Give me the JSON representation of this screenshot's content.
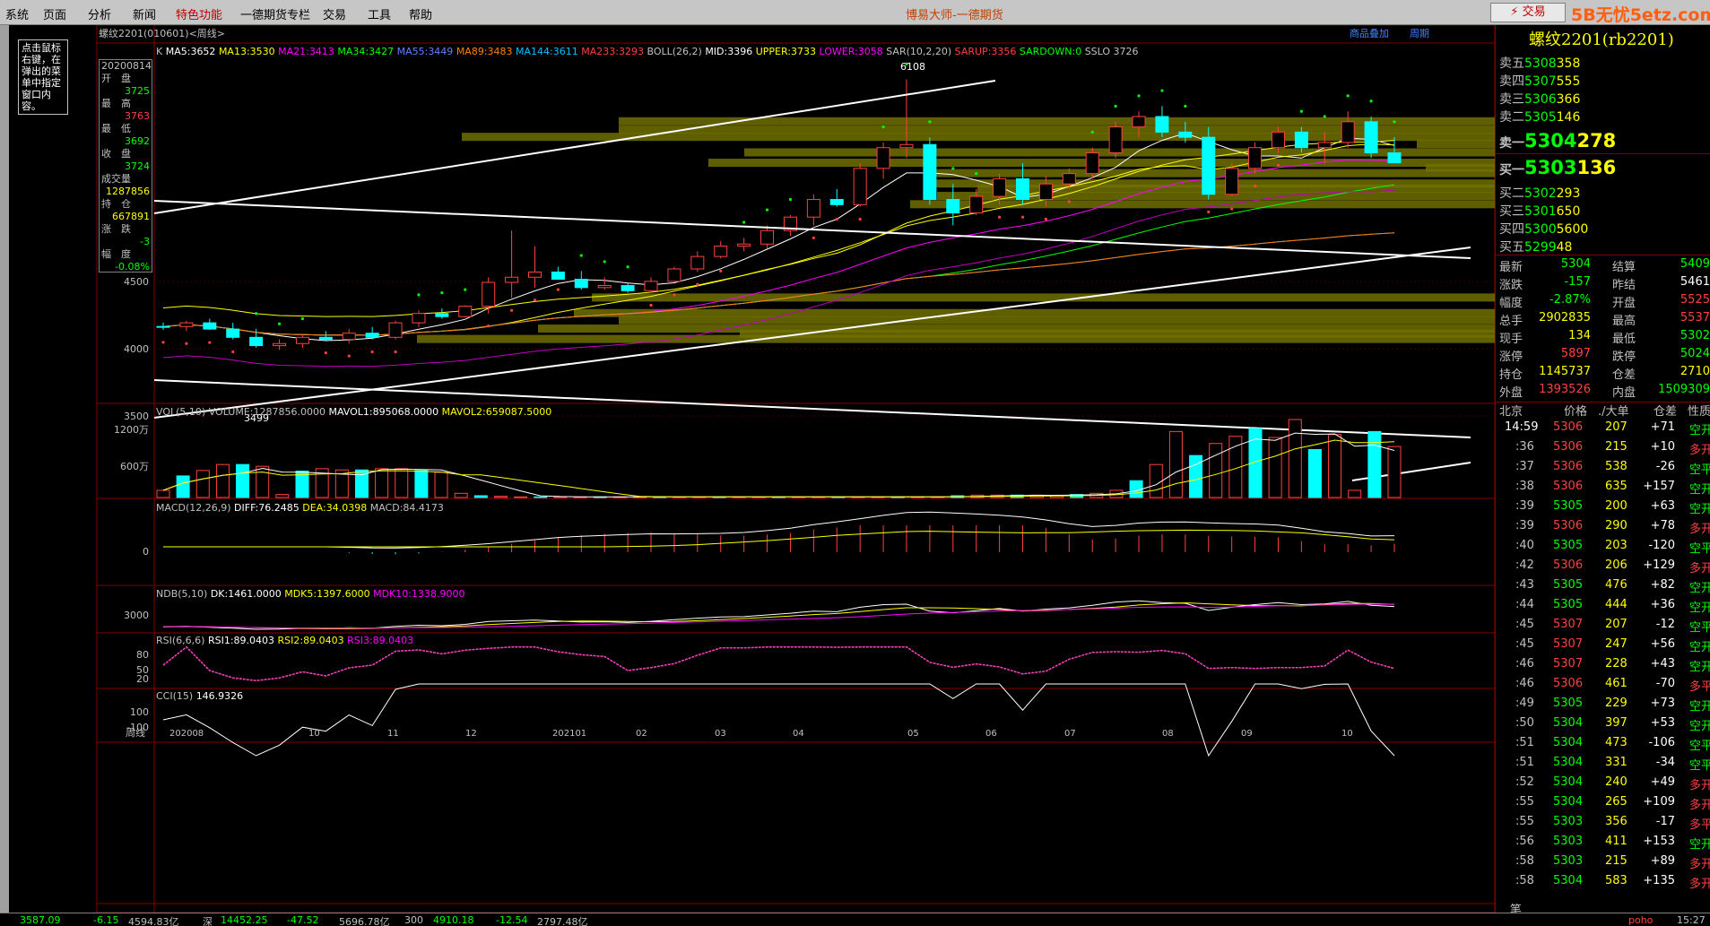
{
  "menu": {
    "items": [
      "系统",
      "页面",
      "分析",
      "新闻",
      "特色功能",
      "一德期货专栏",
      "交易",
      "工具",
      "帮助"
    ],
    "app_title": "博易大师-一德期货",
    "trade_button": "⚡ 交易",
    "watermark": "5B无忧5etz.com"
  },
  "hint": "点击鼠标右键，在弹出的菜单中指定窗口内容。",
  "chart": {
    "symbol_line": "螺纹2201(010601)<周线>",
    "toolbar_links": [
      "商品叠加",
      "周期"
    ],
    "indicator_line": [
      {
        "text": "K",
        "color": "#c0c0c0"
      },
      {
        "text": "MA5:3652",
        "color": "#ffffff"
      },
      {
        "text": "MA13:3530",
        "color": "#ffff00"
      },
      {
        "text": "MA21:3413",
        "color": "#ff00ff"
      },
      {
        "text": "MA34:3427",
        "color": "#00ff00"
      },
      {
        "text": "MA55:3449",
        "color": "#6080ff"
      },
      {
        "text": "MA89:3483",
        "color": "#ff8000"
      },
      {
        "text": "MA144:3611",
        "color": "#00c0ff"
      },
      {
        "text": "MA233:3293",
        "color": "#ff4040"
      },
      {
        "text": "BOLL(26,2)",
        "color": "#c0c0c0"
      },
      {
        "text": "MID:3396",
        "color": "#ffffff"
      },
      {
        "text": "UPPER:3733",
        "color": "#ffff00"
      },
      {
        "text": "LOWER:3058",
        "color": "#ff00ff"
      },
      {
        "text": "SAR(10,2,20)",
        "color": "#c0c0c0"
      },
      {
        "text": "SARUP:3356",
        "color": "#ff4040"
      },
      {
        "text": "SARDOWN:0",
        "color": "#00ff00"
      },
      {
        "text": "SSLO 3726",
        "color": "#c0c0c0"
      }
    ],
    "price_axis": [
      "4500",
      "4000",
      "3500"
    ],
    "marks": {
      "high": "6108",
      "low": "3499"
    },
    "vol_line": [
      {
        "text": "VOL(5,10)",
        "color": "#c0c0c0"
      },
      {
        "text": "VOLUME:1287856.0000",
        "color": "#c0c0c0"
      },
      {
        "text": "MAVOL1:895068.0000",
        "color": "#ffffff"
      },
      {
        "text": "MAVOL2:659087.5000",
        "color": "#ffff00"
      }
    ],
    "vol_axis": [
      "1200万",
      "600万"
    ],
    "macd_line": [
      {
        "text": "MACD(12,26,9)",
        "color": "#c0c0c0"
      },
      {
        "text": "DIFF:76.2485",
        "color": "#ffffff"
      },
      {
        "text": "DEA:34.0398",
        "color": "#ffff00"
      },
      {
        "text": "MACD:84.4173",
        "color": "#c0c0c0"
      }
    ],
    "macd_axis": [
      "0"
    ],
    "ndb_line": [
      {
        "text": "NDB(5,10)",
        "color": "#c0c0c0"
      },
      {
        "text": "DK:1461.0000",
        "color": "#ffffff"
      },
      {
        "text": "MDK5:1397.6000",
        "color": "#ffff00"
      },
      {
        "text": "MDK10:1338.9000",
        "color": "#ff00ff"
      }
    ],
    "ndb_axis": [
      "3000"
    ],
    "rsi_line": [
      {
        "text": "RSI(6,6,6)",
        "color": "#c0c0c0"
      },
      {
        "text": "RSI1:89.0403",
        "color": "#ffffff"
      },
      {
        "text": "RSI2:89.0403",
        "color": "#ffff00"
      },
      {
        "text": "RSI3:89.0403",
        "color": "#ff00ff"
      }
    ],
    "rsi_axis": [
      "80",
      "50",
      "20"
    ],
    "cci_line": [
      {
        "text": "CCI(15)",
        "color": "#c0c0c0"
      },
      {
        "text": "146.9326",
        "color": "#ffffff"
      }
    ],
    "cci_axis": [
      "100",
      "-100"
    ],
    "period_label": "周线",
    "time_axis": [
      "202008",
      "10",
      "11",
      "12",
      "202101",
      "02",
      "03",
      "04",
      "05",
      "06",
      "07",
      "08",
      "09",
      "10"
    ]
  },
  "infobox": [
    {
      "label": "20200814",
      "value": ""
    },
    {
      "label": "开　盘",
      "value": "3725",
      "color": "#00ff00"
    },
    {
      "label": "最　高",
      "value": "3763",
      "color": "#ff4040"
    },
    {
      "label": "最　低",
      "value": "3692",
      "color": "#00ff00"
    },
    {
      "label": "收　盘",
      "value": "3724",
      "color": "#00ff00"
    },
    {
      "label": "成交量",
      "value": "1287856",
      "color": "#ffff00"
    },
    {
      "label": "持　仓",
      "value": "667891",
      "color": "#ffff00"
    },
    {
      "label": "涨　跌",
      "value": "-3",
      "color": "#00ff00"
    },
    {
      "label": "幅　度",
      "value": "-0.08%",
      "color": "#00ff00"
    }
  ],
  "quote": {
    "title": "螺纹2201(rb2201)",
    "asks": [
      {
        "label": "卖五",
        "price": "5308",
        "qty": "358"
      },
      {
        "label": "卖四",
        "price": "5307",
        "qty": "555"
      },
      {
        "label": "卖三",
        "price": "5306",
        "qty": "366"
      },
      {
        "label": "卖二",
        "price": "5305",
        "qty": "146"
      },
      {
        "label": "卖一",
        "price": "5304",
        "qty": "278"
      }
    ],
    "bids": [
      {
        "label": "买一",
        "price": "5303",
        "qty": "136"
      },
      {
        "label": "买二",
        "price": "5302",
        "qty": "293"
      },
      {
        "label": "买三",
        "price": "5301",
        "qty": "650"
      },
      {
        "label": "买四",
        "price": "5300",
        "qty": "5600"
      },
      {
        "label": "买五",
        "price": "5299",
        "qty": "48"
      }
    ],
    "stats": [
      {
        "l1": "最新",
        "v1": "5304",
        "c1": "#00ff00",
        "l2": "结算",
        "v2": "5409",
        "c2": "#00ff00"
      },
      {
        "l1": "涨跌",
        "v1": "-157",
        "c1": "#00ff00",
        "l2": "昨结",
        "v2": "5461",
        "c2": "#ffffff"
      },
      {
        "l1": "幅度",
        "v1": "-2.87%",
        "c1": "#00ff00",
        "l2": "开盘",
        "v2": "5525",
        "c2": "#ff4040"
      },
      {
        "l1": "总手",
        "v1": "2902835",
        "c1": "#ffff00",
        "l2": "最高",
        "v2": "5537",
        "c2": "#ff4040"
      },
      {
        "l1": "现手",
        "v1": "134",
        "c1": "#ffff00",
        "l2": "最低",
        "v2": "5302",
        "c2": "#00ff00"
      },
      {
        "l1": "涨停",
        "v1": "5897",
        "c1": "#ff4040",
        "l2": "跌停",
        "v2": "5024",
        "c2": "#00ff00"
      },
      {
        "l1": "持仓",
        "v1": "1145737",
        "c1": "#ffff00",
        "l2": "仓差",
        "v2": "2710",
        "c2": "#ffff00"
      },
      {
        "l1": "外盘",
        "v1": "1393526",
        "c1": "#ff4040",
        "l2": "内盘",
        "v2": "1509309",
        "c2": "#00ff00"
      }
    ],
    "tick_header": {
      "c1": "北京",
      "c2": "价格",
      "c3": "./大单",
      "c4": "仓差",
      "c5": "性质"
    },
    "ticks": [
      {
        "t": "14:59",
        "p": "5306",
        "v": "207",
        "d": "+71",
        "n": "空开"
      },
      {
        "t": ":36",
        "p": "5306",
        "v": "215",
        "d": "+10",
        "n": "多开"
      },
      {
        "t": ":37",
        "p": "5306",
        "v": "538",
        "d": "-26",
        "n": "空平"
      },
      {
        "t": ":38",
        "p": "5306",
        "v": "635",
        "d": "+157",
        "n": "空开"
      },
      {
        "t": ":39",
        "p": "5305",
        "v": "200",
        "d": "+63",
        "n": "空开"
      },
      {
        "t": ":39",
        "p": "5306",
        "v": "290",
        "d": "+78",
        "n": "多开"
      },
      {
        "t": ":40",
        "p": "5305",
        "v": "203",
        "d": "-120",
        "n": "空平"
      },
      {
        "t": ":42",
        "p": "5306",
        "v": "206",
        "d": "+129",
        "n": "多开"
      },
      {
        "t": ":43",
        "p": "5305",
        "v": "476",
        "d": "+82",
        "n": "空开"
      },
      {
        "t": ":44",
        "p": "5305",
        "v": "444",
        "d": "+36",
        "n": "空开"
      },
      {
        "t": ":45",
        "p": "5307",
        "v": "207",
        "d": "-12",
        "n": "空平"
      },
      {
        "t": ":45",
        "p": "5307",
        "v": "247",
        "d": "+56",
        "n": "空开"
      },
      {
        "t": ":46",
        "p": "5307",
        "v": "228",
        "d": "+43",
        "n": "空开"
      },
      {
        "t": ":46",
        "p": "5306",
        "v": "461",
        "d": "-70",
        "n": "多平"
      },
      {
        "t": ":49",
        "p": "5305",
        "v": "229",
        "d": "+73",
        "n": "空开"
      },
      {
        "t": ":50",
        "p": "5304",
        "v": "397",
        "d": "+53",
        "n": "空开"
      },
      {
        "t": ":51",
        "p": "5304",
        "v": "473",
        "d": "-106",
        "n": "空平"
      },
      {
        "t": ":51",
        "p": "5304",
        "v": "331",
        "d": "-34",
        "n": "空平"
      },
      {
        "t": ":52",
        "p": "5304",
        "v": "240",
        "d": "+49",
        "n": "多开"
      },
      {
        "t": ":55",
        "p": "5304",
        "v": "265",
        "d": "+109",
        "n": "多开"
      },
      {
        "t": ":55",
        "p": "5303",
        "v": "356",
        "d": "-17",
        "n": "多平"
      },
      {
        "t": ":56",
        "p": "5303",
        "v": "411",
        "d": "+153",
        "n": "空开"
      },
      {
        "t": ":58",
        "p": "5303",
        "v": "215",
        "d": "+89",
        "n": "多开"
      },
      {
        "t": ":58",
        "p": "5304",
        "v": "583",
        "d": "+135",
        "n": "多开"
      }
    ],
    "footer_label": "笔"
  },
  "statusbar": [
    {
      "text": "3587.09",
      "color": "#00ff00"
    },
    {
      "text": "-6.15",
      "color": "#00ff00"
    },
    {
      "text": "4594.83亿",
      "color": "#c0c0c0"
    },
    {
      "text": "深",
      "color": "#c0c0c0"
    },
    {
      "text": "14452.25",
      "color": "#00ff00"
    },
    {
      "text": "-47.52",
      "color": "#00ff00"
    },
    {
      "text": "5696.78亿",
      "color": "#c0c0c0"
    },
    {
      "text": "300",
      "color": "#c0c0c0"
    },
    {
      "text": "4910.18",
      "color": "#00ff00"
    },
    {
      "text": "-12.54",
      "color": "#00ff00"
    },
    {
      "text": "2797.48亿",
      "color": "#c0c0c0"
    },
    {
      "text": "poho",
      "color": "#ff4040"
    },
    {
      "text": "15:27",
      "color": "#c0c0c0"
    }
  ],
  "candles": [
    [
      3725,
      3763,
      3692,
      3724
    ],
    [
      3724,
      3780,
      3680,
      3760
    ],
    [
      3760,
      3800,
      3690,
      3700
    ],
    [
      3700,
      3760,
      3600,
      3620
    ],
    [
      3620,
      3700,
      3520,
      3540
    ],
    [
      3540,
      3600,
      3499,
      3560
    ],
    [
      3560,
      3650,
      3520,
      3620
    ],
    [
      3620,
      3680,
      3590,
      3600
    ],
    [
      3600,
      3700,
      3560,
      3660
    ],
    [
      3660,
      3720,
      3600,
      3620
    ],
    [
      3620,
      3780,
      3600,
      3760
    ],
    [
      3760,
      3880,
      3720,
      3850
    ],
    [
      3850,
      3900,
      3800,
      3820
    ],
    [
      3820,
      3930,
      3810,
      3920
    ],
    [
      3920,
      4200,
      3850,
      4150
    ],
    [
      4150,
      4650,
      4000,
      4200
    ],
    [
      4200,
      4500,
      4100,
      4250
    ],
    [
      4250,
      4300,
      4200,
      4180
    ],
    [
      4180,
      4260,
      4080,
      4100
    ],
    [
      4100,
      4200,
      4080,
      4120
    ],
    [
      4120,
      4150,
      4050,
      4070
    ],
    [
      4070,
      4200,
      4050,
      4160
    ],
    [
      4160,
      4300,
      4150,
      4280
    ],
    [
      4280,
      4450,
      4250,
      4400
    ],
    [
      4400,
      4550,
      4380,
      4500
    ],
    [
      4500,
      4580,
      4450,
      4520
    ],
    [
      4520,
      4700,
      4480,
      4650
    ],
    [
      4650,
      4800,
      4600,
      4780
    ],
    [
      4780,
      5000,
      4700,
      4950
    ],
    [
      4950,
      5050,
      4880,
      4900
    ],
    [
      4900,
      5300,
      4880,
      5250
    ],
    [
      5250,
      5500,
      5150,
      5450
    ],
    [
      5450,
      6108,
      5350,
      5480
    ],
    [
      5480,
      5550,
      4900,
      4950
    ],
    [
      4950,
      5100,
      4700,
      4820
    ],
    [
      4820,
      5050,
      4800,
      4980
    ],
    [
      4980,
      5200,
      4900,
      5150
    ],
    [
      5150,
      5300,
      4900,
      4950
    ],
    [
      4950,
      5180,
      4880,
      5100
    ],
    [
      5100,
      5250,
      5050,
      5200
    ],
    [
      5200,
      5450,
      5150,
      5400
    ],
    [
      5400,
      5700,
      5350,
      5650
    ],
    [
      5650,
      5800,
      5550,
      5750
    ],
    [
      5750,
      5850,
      5550,
      5600
    ],
    [
      5600,
      5700,
      5500,
      5550
    ],
    [
      5550,
      5650,
      4950,
      5000
    ],
    [
      5000,
      5300,
      4980,
      5250
    ],
    [
      5250,
      5500,
      5200,
      5450
    ],
    [
      5450,
      5650,
      5400,
      5600
    ],
    [
      5600,
      5650,
      5400,
      5450
    ],
    [
      5450,
      5600,
      5300,
      5500
    ],
    [
      5500,
      5800,
      5450,
      5700
    ],
    [
      5700,
      5750,
      5350,
      5400
    ],
    [
      5400,
      5550,
      5300,
      5304
    ]
  ],
  "volumes": [
    12,
    36,
    45,
    55,
    55,
    52,
    5,
    44,
    48,
    46,
    46,
    48,
    48,
    45,
    42,
    7,
    3,
    2,
    1,
    1,
    1,
    1,
    1,
    1,
    1,
    1,
    1,
    1,
    1,
    1,
    1,
    1,
    1,
    1,
    1,
    1,
    1,
    1,
    1,
    1,
    3,
    4,
    4,
    4,
    4,
    3,
    5,
    7,
    12,
    28,
    55,
    110,
    70,
    90,
    102,
    115,
    100,
    130,
    80,
    105,
    12,
    110,
    85
  ]
}
